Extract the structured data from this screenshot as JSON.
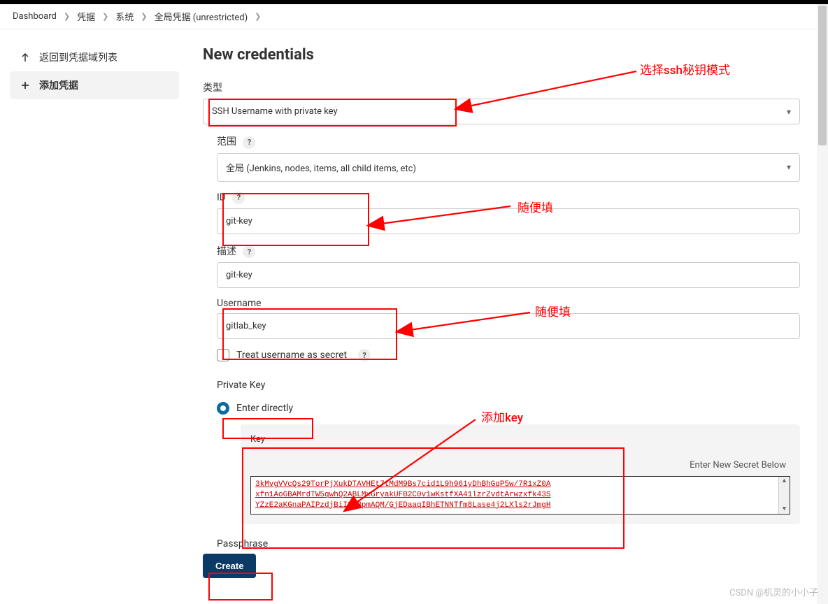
{
  "breadcrumb": [
    "Dashboard",
    "凭据",
    "系统",
    "全局凭据 (unrestricted)"
  ],
  "sidebar": {
    "back": "返回到凭据域列表",
    "add": "添加凭据"
  },
  "title": "New credentials",
  "labels": {
    "type": "类型",
    "scope": "范围",
    "id": "ID",
    "desc": "描述",
    "username": "Username",
    "treat_secret": "Treat username as secret",
    "private_key": "Private Key",
    "enter_directly": "Enter directly",
    "key": "Key",
    "secret_note": "Enter New Secret Below",
    "passphrase": "Passphrase"
  },
  "values": {
    "type": "SSH Username with private key",
    "scope": "全局 (Jenkins, nodes, items, all child items, etc)",
    "id": "git-key",
    "desc": "git-key",
    "username": "gitlab_key",
    "key_text": "3kMvgVVcQs29TorPjXukDTAVHEt7tMdM9Bs7cid1L9h961yDhBhGqP5w/7R1xZ0A\nxfn1AoGBAMrdTW5qwhQ2ABLMxGryakUFB2C0v1wKstfXA41lzrZvdtArwzxfk43S\nYZzE2aKGnaPAIPzdjBiI2FBpmAQM/GjEDaaqIBhETNNTfm8Lase4j2LXls2rJmgH"
  },
  "buttons": {
    "create": "Create"
  },
  "annotations": {
    "a1": "选择ssh秘钥模式",
    "a2": "随便填",
    "a3": "随便填",
    "a4": "添加key"
  },
  "watermark": "CSDN @机灵的小小子"
}
